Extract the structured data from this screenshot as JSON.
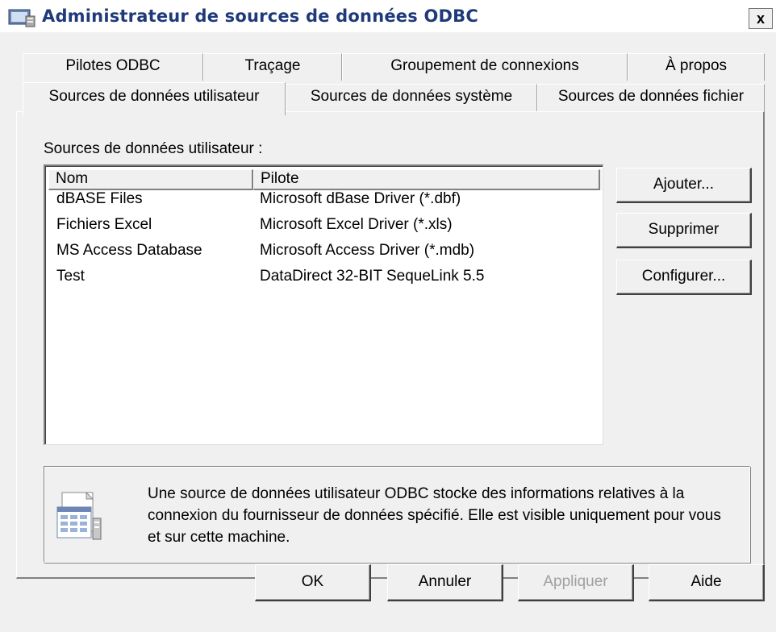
{
  "window": {
    "title": "Administrateur de sources de données ODBC",
    "close_glyph": "x",
    "icon": "odbc-app-icon"
  },
  "tabs_row1": [
    {
      "label": "Pilotes ODBC"
    },
    {
      "label": "Traçage"
    },
    {
      "label": "Groupement de connexions"
    },
    {
      "label": "À propos"
    }
  ],
  "tabs_row2": [
    {
      "label": "Sources de données utilisateur",
      "active": true
    },
    {
      "label": "Sources de données système"
    },
    {
      "label": "Sources de données fichier"
    }
  ],
  "panel": {
    "section_label": "Sources de données utilisateur :",
    "columns": [
      "Nom",
      "Pilote"
    ],
    "rows": [
      {
        "name": "dBASE Files",
        "driver": "Microsoft dBase Driver (*.dbf)"
      },
      {
        "name": "Fichiers Excel",
        "driver": "Microsoft Excel Driver (*.xls)"
      },
      {
        "name": "MS Access Database",
        "driver": "Microsoft Access Driver (*.mdb)"
      },
      {
        "name": "Test",
        "driver": "DataDirect 32-BIT SequeLink 5.5"
      }
    ],
    "side_buttons": {
      "add": "Ajouter...",
      "remove": "Supprimer",
      "configure": "Configurer..."
    },
    "info_text": "Une source de données utilisateur ODBC stocke des informations relatives à la connexion du fournisseur de données spécifié. Elle est visible uniquement pour vous et sur cette machine.",
    "info_icon": "data-source-icon"
  },
  "footer": {
    "ok": "OK",
    "cancel": "Annuler",
    "apply": "Appliquer",
    "help": "Aide"
  },
  "colors": {
    "face": "#f0f0f0",
    "title_text": "#1f3a7a",
    "disabled_text": "#a0a0a0"
  }
}
